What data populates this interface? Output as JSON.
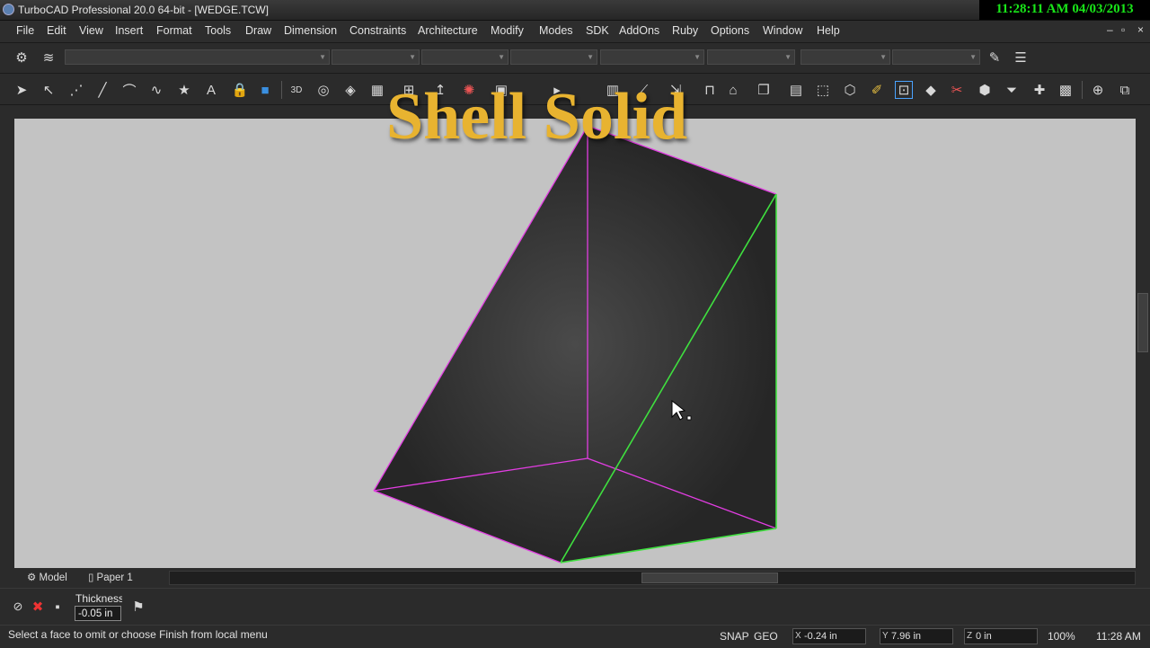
{
  "window": {
    "title": "TurboCAD Professional 20.0 64-bit - [WEDGE.TCW]",
    "clock": "11:28:11 AM 04/03/2013",
    "controls": [
      "–",
      "▫",
      "×"
    ]
  },
  "menu": [
    "File",
    "Edit",
    "View",
    "Insert",
    "Format",
    "Tools",
    "Draw",
    "Dimension",
    "Constraints",
    "Architecture",
    "Modify",
    "Modes",
    "SDK",
    "AddOns",
    "Ruby",
    "Options",
    "Window",
    "Help"
  ],
  "overlay_caption": "Shell Solid",
  "tabs": {
    "model": "Model",
    "paper": "Paper 1"
  },
  "inspector": {
    "thickness_label": "Thickness",
    "thickness_value": "-0.05 in"
  },
  "status": {
    "message": "Select a face to omit or choose Finish from local menu",
    "snap": "SNAP",
    "geo": "GEO",
    "x_axis": "X",
    "x_value": "-0.24 in",
    "y_axis": "Y",
    "y_value": "7.96 in",
    "z_axis": "Z",
    "z_value": "0 in",
    "zoom": "100%",
    "time": "11:28 AM"
  },
  "colors": {
    "edge_magenta": "#e23de2",
    "edge_green": "#3fe03f",
    "caption": "#e8b330",
    "canvas": "#c3c3c3",
    "clock_text": "#19e619"
  }
}
